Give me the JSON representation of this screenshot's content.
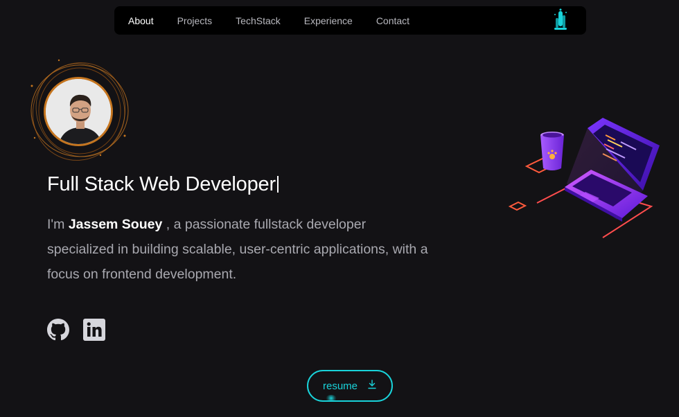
{
  "nav": {
    "links": [
      {
        "label": "About",
        "active": true
      },
      {
        "label": "Projects",
        "active": false
      },
      {
        "label": "TechStack",
        "active": false
      },
      {
        "label": "Experience",
        "active": false
      },
      {
        "label": "Contact",
        "active": false
      }
    ],
    "logo_icon": "brand-logo-icon"
  },
  "hero": {
    "headline": "Full Stack Web Developer",
    "intro_prefix": "I'm ",
    "name": "Jassem Souey",
    "intro_suffix": " , a passionate fullstack developer specialized in building scalable, user-centric applications, with a focus on frontend development."
  },
  "socials": {
    "github_icon": "github-icon",
    "linkedin_icon": "linkedin-icon"
  },
  "resume": {
    "label": "resume",
    "icon": "download-icon"
  },
  "colors": {
    "background": "#131215",
    "accent": "#19d3da",
    "avatar_ring": "#c5751f",
    "laptop": "#6b1fe0",
    "outline_red": "#ff4d4d"
  }
}
